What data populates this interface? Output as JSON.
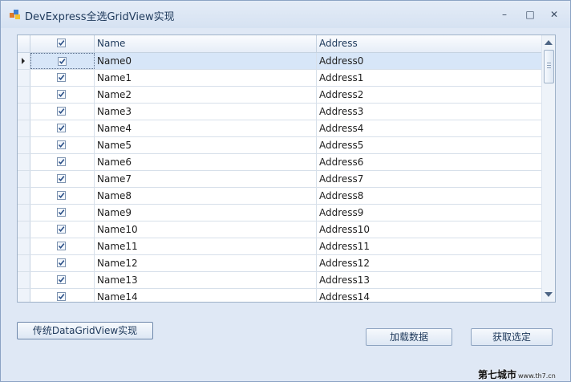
{
  "window": {
    "title": "DevExpress全选GridView实现",
    "minimize_glyph": "–",
    "maximize_glyph": "□",
    "close_glyph": "✕"
  },
  "grid": {
    "columns": {
      "name": "Name",
      "address": "Address"
    },
    "focused_row": 0,
    "rows": [
      {
        "checked": true,
        "name": "Name0",
        "address": "Address0"
      },
      {
        "checked": true,
        "name": "Name1",
        "address": "Address1"
      },
      {
        "checked": true,
        "name": "Name2",
        "address": "Address2"
      },
      {
        "checked": true,
        "name": "Name3",
        "address": "Address3"
      },
      {
        "checked": true,
        "name": "Name4",
        "address": "Address4"
      },
      {
        "checked": true,
        "name": "Name5",
        "address": "Address5"
      },
      {
        "checked": true,
        "name": "Name6",
        "address": "Address6"
      },
      {
        "checked": true,
        "name": "Name7",
        "address": "Address7"
      },
      {
        "checked": true,
        "name": "Name8",
        "address": "Address8"
      },
      {
        "checked": true,
        "name": "Name9",
        "address": "Address9"
      },
      {
        "checked": true,
        "name": "Name10",
        "address": "Address10"
      },
      {
        "checked": true,
        "name": "Name11",
        "address": "Address11"
      },
      {
        "checked": true,
        "name": "Name12",
        "address": "Address12"
      },
      {
        "checked": true,
        "name": "Name13",
        "address": "Address13"
      },
      {
        "checked": true,
        "name": "Name14",
        "address": "Address14"
      }
    ]
  },
  "buttons": {
    "datagridview": "传统DataGridView实现",
    "load": "加载数据",
    "get_selected": "获取选定"
  },
  "watermark": {
    "main": "第七城市",
    "small": "www.th7.cn"
  },
  "colors": {
    "focused_row": "#d7e6f8",
    "accent": "#1e395b"
  }
}
